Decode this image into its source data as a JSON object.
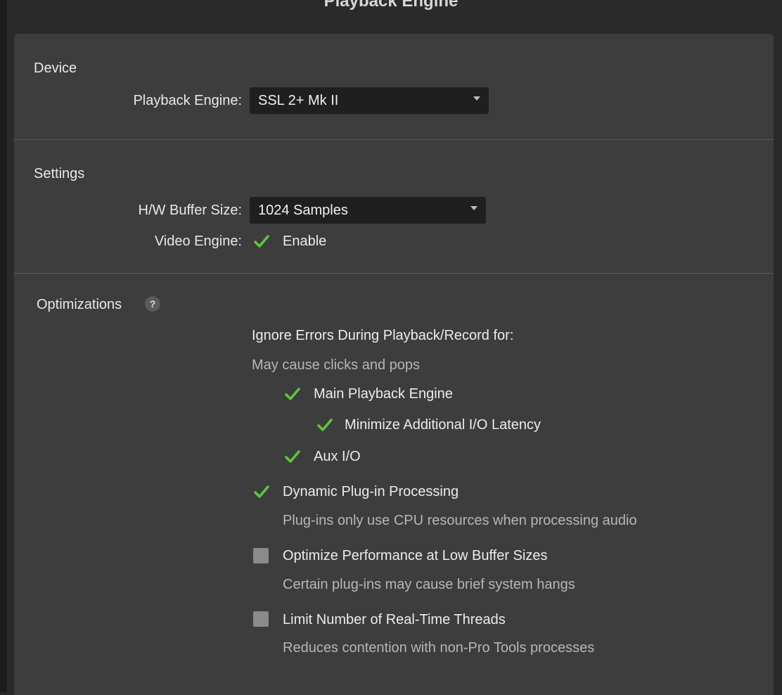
{
  "window": {
    "title": "Playback Engine"
  },
  "device": {
    "section_title": "Device",
    "playback_engine_label": "Playback Engine:",
    "playback_engine_value": "SSL 2+ Mk II"
  },
  "settings": {
    "section_title": "Settings",
    "buffer_label": "H/W Buffer Size:",
    "buffer_value": "1024 Samples",
    "video_label": "Video Engine:",
    "video_enable_label": "Enable",
    "video_enable_checked": true
  },
  "optimizations": {
    "section_title": "Optimizations",
    "help_glyph": "?",
    "ignore_heading": "Ignore Errors During Playback/Record for:",
    "ignore_note": "May cause clicks and pops",
    "main_playback_label": "Main Playback Engine",
    "main_playback_checked": true,
    "minimize_latency_label": "Minimize Additional I/O Latency",
    "minimize_latency_checked": true,
    "aux_io_label": "Aux I/O",
    "aux_io_checked": true,
    "dynamic_label": "Dynamic Plug-in Processing",
    "dynamic_checked": true,
    "dynamic_desc": "Plug-ins only use CPU resources when processing audio",
    "low_buffer_label": "Optimize Performance at Low Buffer Sizes",
    "low_buffer_checked": false,
    "low_buffer_desc": "Certain plug-ins may cause brief system hangs",
    "threads_label": "Limit Number of Real-Time Threads",
    "threads_checked": false,
    "threads_desc": "Reduces contention with non-Pro Tools processes"
  },
  "colors": {
    "panel_bg": "#3d3d3d",
    "check_green": "#5ec441",
    "unchecked_box": "#8a8a8a"
  }
}
